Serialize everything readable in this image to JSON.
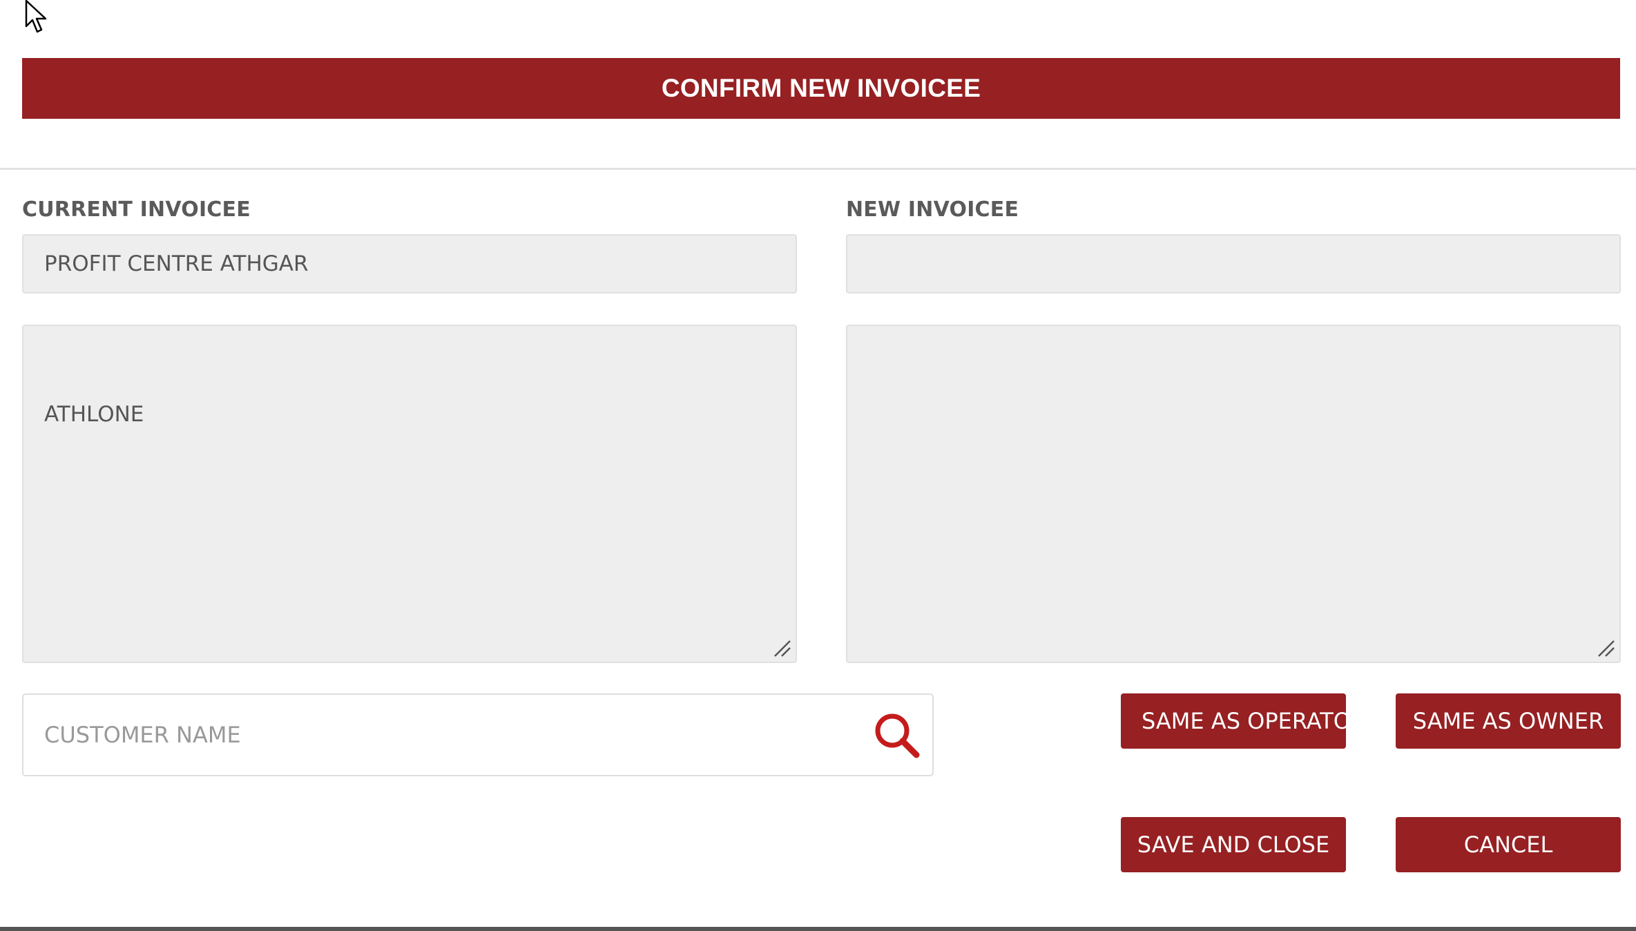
{
  "dialog": {
    "title": "CONFIRM NEW INVOICEE"
  },
  "current_invoicee": {
    "label": "CURRENT INVOICEE",
    "name": "PROFIT CENTRE ATHGAR",
    "address": "ATHLONE"
  },
  "new_invoicee": {
    "label": "NEW INVOICEE",
    "name": "",
    "address": ""
  },
  "search": {
    "placeholder": "CUSTOMER NAME",
    "icon": "search-icon"
  },
  "buttons": {
    "same_as_operator": "SAME AS OPERATO",
    "same_as_owner": "SAME AS OWNER",
    "save_and_close": "SAVE AND CLOSE",
    "cancel": "CANCEL"
  },
  "colors": {
    "accent": "#962022",
    "field_bg": "#eeeeee"
  }
}
